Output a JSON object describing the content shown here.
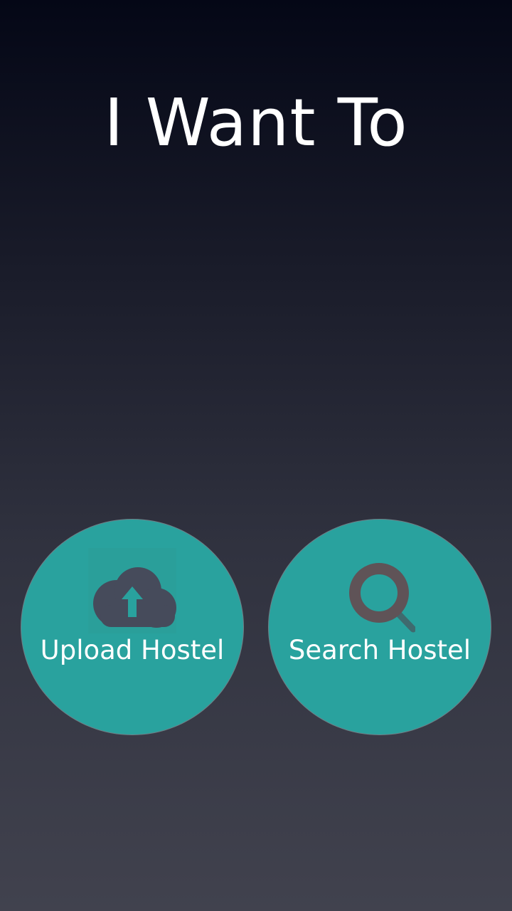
{
  "header": {
    "title": "I Want To"
  },
  "actions": [
    {
      "label": "Upload Hostel",
      "icon": "cloud-upload-icon"
    },
    {
      "label": "Search Hostel",
      "icon": "magnifier-search-icon"
    }
  ],
  "colors": {
    "background_top": "#040716",
    "background_bottom": "#41424e",
    "button_fill": "#29a29e",
    "button_border": "#6f7f86",
    "icon_dark": "#464b5b",
    "search_icon": "#5f5357"
  }
}
